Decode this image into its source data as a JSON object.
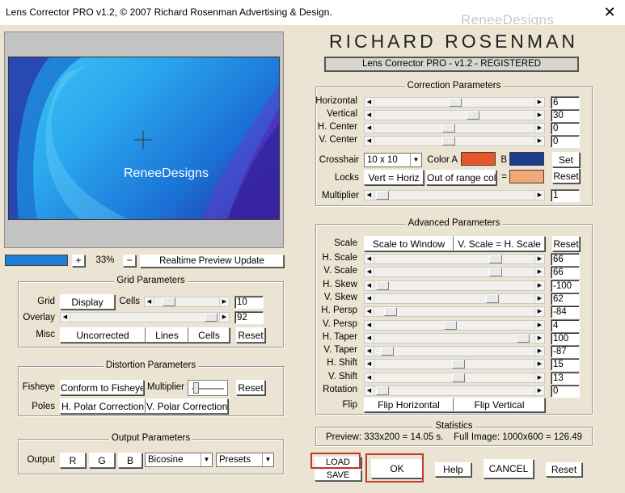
{
  "window": {
    "title": "Lens Corrector PRO v1.2, © 2007 Richard Rosenman Advertising & Design.",
    "watermark": "ReneeDesigns",
    "close_glyph": "✕"
  },
  "brand": {
    "name": "RICHARD ROSENMAN",
    "product": "Lens Corrector PRO - v1.2 - REGISTERED"
  },
  "preview": {
    "watermark": "ReneeDesigns",
    "zoom_plus": "+",
    "zoom_value": "33%",
    "zoom_minus": "−",
    "realtime_label": "Realtime Preview Update"
  },
  "grid": {
    "title": "Grid Parameters",
    "grid_label": "Grid",
    "display_btn": "Display",
    "cells_label": "Cells",
    "cells_value": "10",
    "overlay_label": "Overlay",
    "overlay_value": "92",
    "misc_label": "Misc",
    "uncorrected_btn": "Uncorrected",
    "lines_btn": "Lines",
    "cells_btn": "Cells",
    "reset_btn": "Reset"
  },
  "distortion": {
    "title": "Distortion Parameters",
    "fisheye_label": "Fisheye",
    "conform_btn": "Conform to Fisheye",
    "multiplier_label": "Multiplier",
    "reset_btn": "Reset",
    "poles_label": "Poles",
    "hpolar_btn": "H. Polar Correction",
    "vpolar_btn": "V. Polar Correction"
  },
  "output": {
    "title": "Output Parameters",
    "output_label": "Output",
    "r_btn": "R",
    "g_btn": "G",
    "b_btn": "B",
    "interp_value": "Bicosine",
    "presets_value": "Presets"
  },
  "correction": {
    "title": "Correction Parameters",
    "rows": [
      {
        "label": "Horizontal",
        "value": "6"
      },
      {
        "label": "Vertical",
        "value": "30"
      },
      {
        "label": "H. Center",
        "value": "0"
      },
      {
        "label": "V. Center",
        "value": "0"
      }
    ],
    "crosshair_label": "Crosshair",
    "crosshair_value": "10 x 10",
    "color_a_label": "Color A",
    "color_a": "#e8572c",
    "b_label": "B",
    "color_b": "#1a3e8c",
    "set_btn": "Set",
    "locks_label": "Locks",
    "vert_horiz_btn": "Vert = Horiz",
    "out_of_range_btn": "Out of range col",
    "equals": "=",
    "out_color": "#f3a878",
    "reset_btn": "Reset",
    "multiplier_label": "Multiplier",
    "multiplier_value": "1"
  },
  "advanced": {
    "title": "Advanced Parameters",
    "scale_label": "Scale",
    "scale_to_window_btn": "Scale to Window",
    "v_scale_btn": "V. Scale = H. Scale",
    "reset_btn": "Reset",
    "rows": [
      {
        "label": "H. Scale",
        "value": "66"
      },
      {
        "label": "V. Scale",
        "value": "66"
      },
      {
        "label": "H. Skew",
        "value": "-100"
      },
      {
        "label": "V. Skew",
        "value": "62"
      },
      {
        "label": "H. Persp",
        "value": "-84"
      },
      {
        "label": "V. Persp",
        "value": "4"
      },
      {
        "label": "H. Taper",
        "value": "100"
      },
      {
        "label": "V. Taper",
        "value": "-87"
      },
      {
        "label": "H. Shift",
        "value": "15"
      },
      {
        "label": "V. Shift",
        "value": "13"
      },
      {
        "label": "Rotation",
        "value": "0"
      }
    ],
    "flip_label": "Flip",
    "flip_h_btn": "Flip Horizontal",
    "flip_v_btn": "Flip Vertical"
  },
  "statistics": {
    "title": "Statistics",
    "text": "Preview: 333x200 = 14.05 s.    Full Image: 1000x600 = 126.49"
  },
  "footer": {
    "load_btn": "LOAD",
    "save_btn": "SAVE",
    "ok_btn": "OK",
    "help_btn": "Help",
    "cancel_btn": "CANCEL",
    "reset_btn": "Reset"
  },
  "colors": {
    "highlight_box": "#c0392b",
    "progress": "#1f7fd6"
  }
}
